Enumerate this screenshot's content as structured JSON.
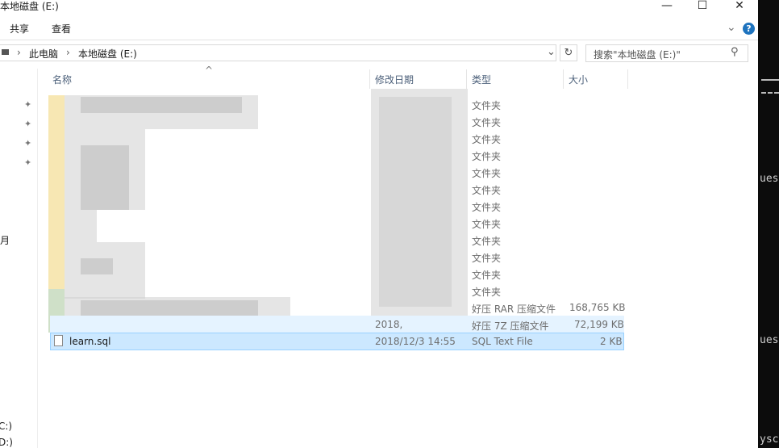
{
  "window": {
    "title": "本地磁盘 (E:)",
    "minimize_glyph": "—",
    "maximize_glyph": "☐",
    "close_glyph": "✕"
  },
  "ribbon": {
    "tabs": [
      "共享",
      "查看"
    ],
    "expand_glyph": "⌄",
    "help_glyph": "?"
  },
  "address": {
    "crumbs": [
      "此电脑",
      "本地磁盘 (E:)"
    ],
    "separator": "›",
    "dropdown_glyph": "⌄",
    "refresh_glyph": "↻",
    "search_placeholder": "搜索\"本地磁盘 (E:)\"",
    "search_glyph": "⚲"
  },
  "nav": {
    "labels": [
      "月",
      "C:)",
      "D:)"
    ],
    "pin_glyph": "📌"
  },
  "columns": {
    "sort_glyph": "^",
    "name": "名称",
    "date": "修改日期",
    "type": "类型",
    "size": "大小"
  },
  "rows": [
    {
      "date": "",
      "type": "文件夹",
      "size": ""
    },
    {
      "date": "",
      "type": "文件夹",
      "size": ""
    },
    {
      "date": "",
      "type": "文件夹",
      "size": ""
    },
    {
      "date": "",
      "type": "文件夹",
      "size": ""
    },
    {
      "date": "",
      "type": "文件夹",
      "size": ""
    },
    {
      "date": "",
      "type": "文件夹",
      "size": ""
    },
    {
      "date": "",
      "type": "文件夹",
      "size": ""
    },
    {
      "date": "",
      "type": "文件夹",
      "size": ""
    },
    {
      "date": "",
      "type": "文件夹",
      "size": ""
    },
    {
      "date": "",
      "type": "文件夹",
      "size": ""
    },
    {
      "date": "",
      "type": "文件夹",
      "size": ""
    },
    {
      "date": "",
      "type": "文件夹",
      "size": ""
    },
    {
      "date": "",
      "type": "好压 RAR 压缩文件",
      "size": "168,765 KB"
    },
    {
      "date": "2018,",
      "type": "好压 7Z 压缩文件",
      "size": "72,199 KB"
    },
    {
      "name": "learn.sql",
      "date": "2018/12/3 14:55",
      "type": "SQL Text File",
      "size": "2 KB"
    }
  ],
  "terminal": {
    "lines": [
      "ues",
      "ues",
      "ysc"
    ]
  },
  "colors": {
    "selection": "#cce8ff",
    "header_text": "#4c607a",
    "help_blue": "#1e73be"
  }
}
